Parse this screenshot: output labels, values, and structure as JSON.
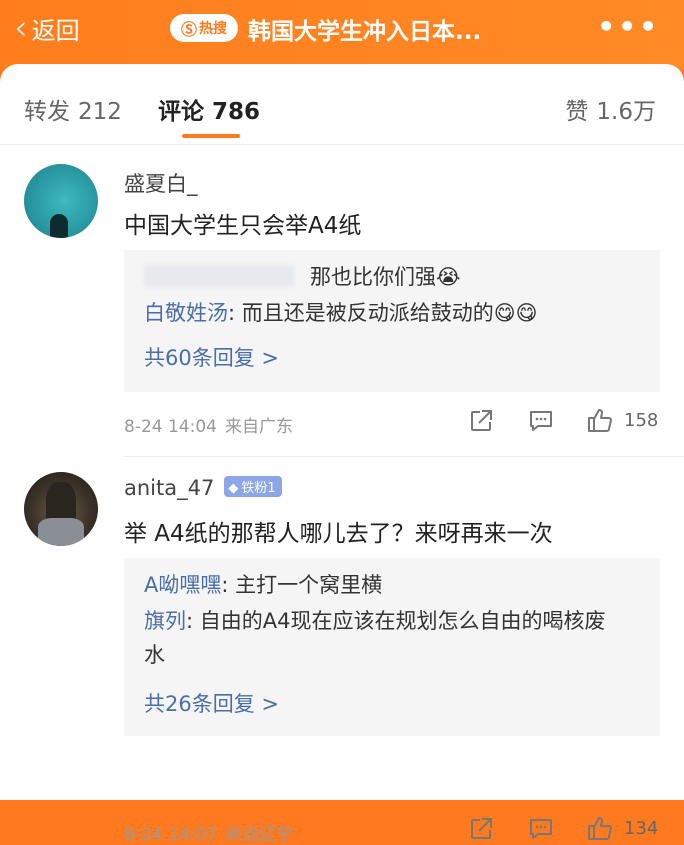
{
  "header": {
    "back_label": "返回",
    "hot_label": "热搜",
    "title": "韩国大学生冲入日本..."
  },
  "tabs": [
    {
      "label": "转发",
      "count": "212"
    },
    {
      "label": "评论",
      "count": "786"
    },
    {
      "label": "赞",
      "count": "1.6万"
    }
  ],
  "comments": [
    {
      "username": "盛夏白_",
      "text": "中国大学生只会举A4纸",
      "replies": [
        {
          "who": "",
          "text": "那也比你们强😭"
        },
        {
          "who": "白敬姓汤",
          "text": ": 而且还是被反动派给鼓动的😋😋"
        }
      ],
      "more_replies": "共60条回复 >",
      "time": "8-24 14:04",
      "location": "来自广东",
      "likes": "158"
    },
    {
      "username": "anita_47",
      "badge": "铁粉1",
      "text": "举 A4纸的那帮人哪儿去了？来呀再来一次",
      "replies": [
        {
          "who": "A呦嘿嘿",
          "text": ": 主打一个窝里横"
        },
        {
          "who": "旗列",
          "text": ": 自由的A4现在应该在规划怎么自由的喝核废水"
        }
      ],
      "more_replies": "共26条回复 >",
      "time": "8-24 14:07",
      "location": "来自辽宁",
      "likes": "134"
    }
  ],
  "colors": {
    "brand": "#ff7a1f",
    "link": "#4a6eaa",
    "reply_bg": "#f5f5f5"
  }
}
